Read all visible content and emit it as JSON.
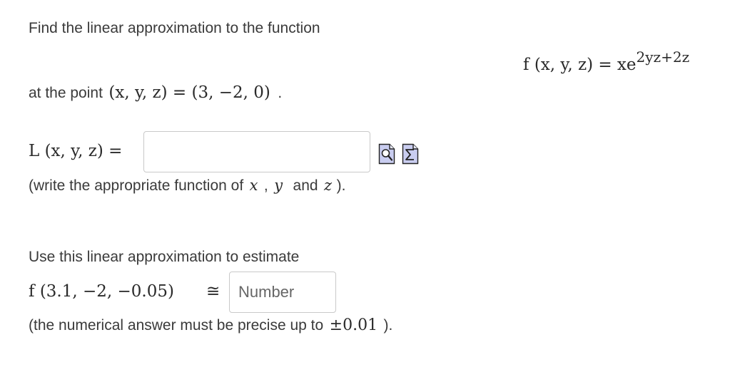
{
  "question": {
    "intro": "Find the linear approximation to the function",
    "function_formula": {
      "lhs": "f (x, y, z) = xe",
      "exponent": "2yz+2z"
    },
    "point_prefix": "at the point",
    "point_math": "(x, y, z) = (3, −2, 0)",
    "point_suffix": "."
  },
  "linear_answer": {
    "label": "L (x, y, z) =",
    "value": "",
    "placeholder": "",
    "preview_icon": "preview-magnifier-icon",
    "equation_icon": "equation-sigma-icon",
    "hint_prefix": "(write the appropriate function of",
    "hint_vars": [
      "x",
      "y",
      "z"
    ],
    "hint_sep": ",",
    "hint_and": "and",
    "hint_suffix": ")."
  },
  "estimate": {
    "intro": "Use this linear approximation to estimate",
    "expression": "f (3.1, −2, −0.05)",
    "approx_symbol": "≅",
    "input_value": "",
    "input_placeholder": "Number",
    "precision_prefix": "(the numerical answer must be precise up to",
    "precision_value": "±0.01",
    "precision_suffix": ")."
  }
}
